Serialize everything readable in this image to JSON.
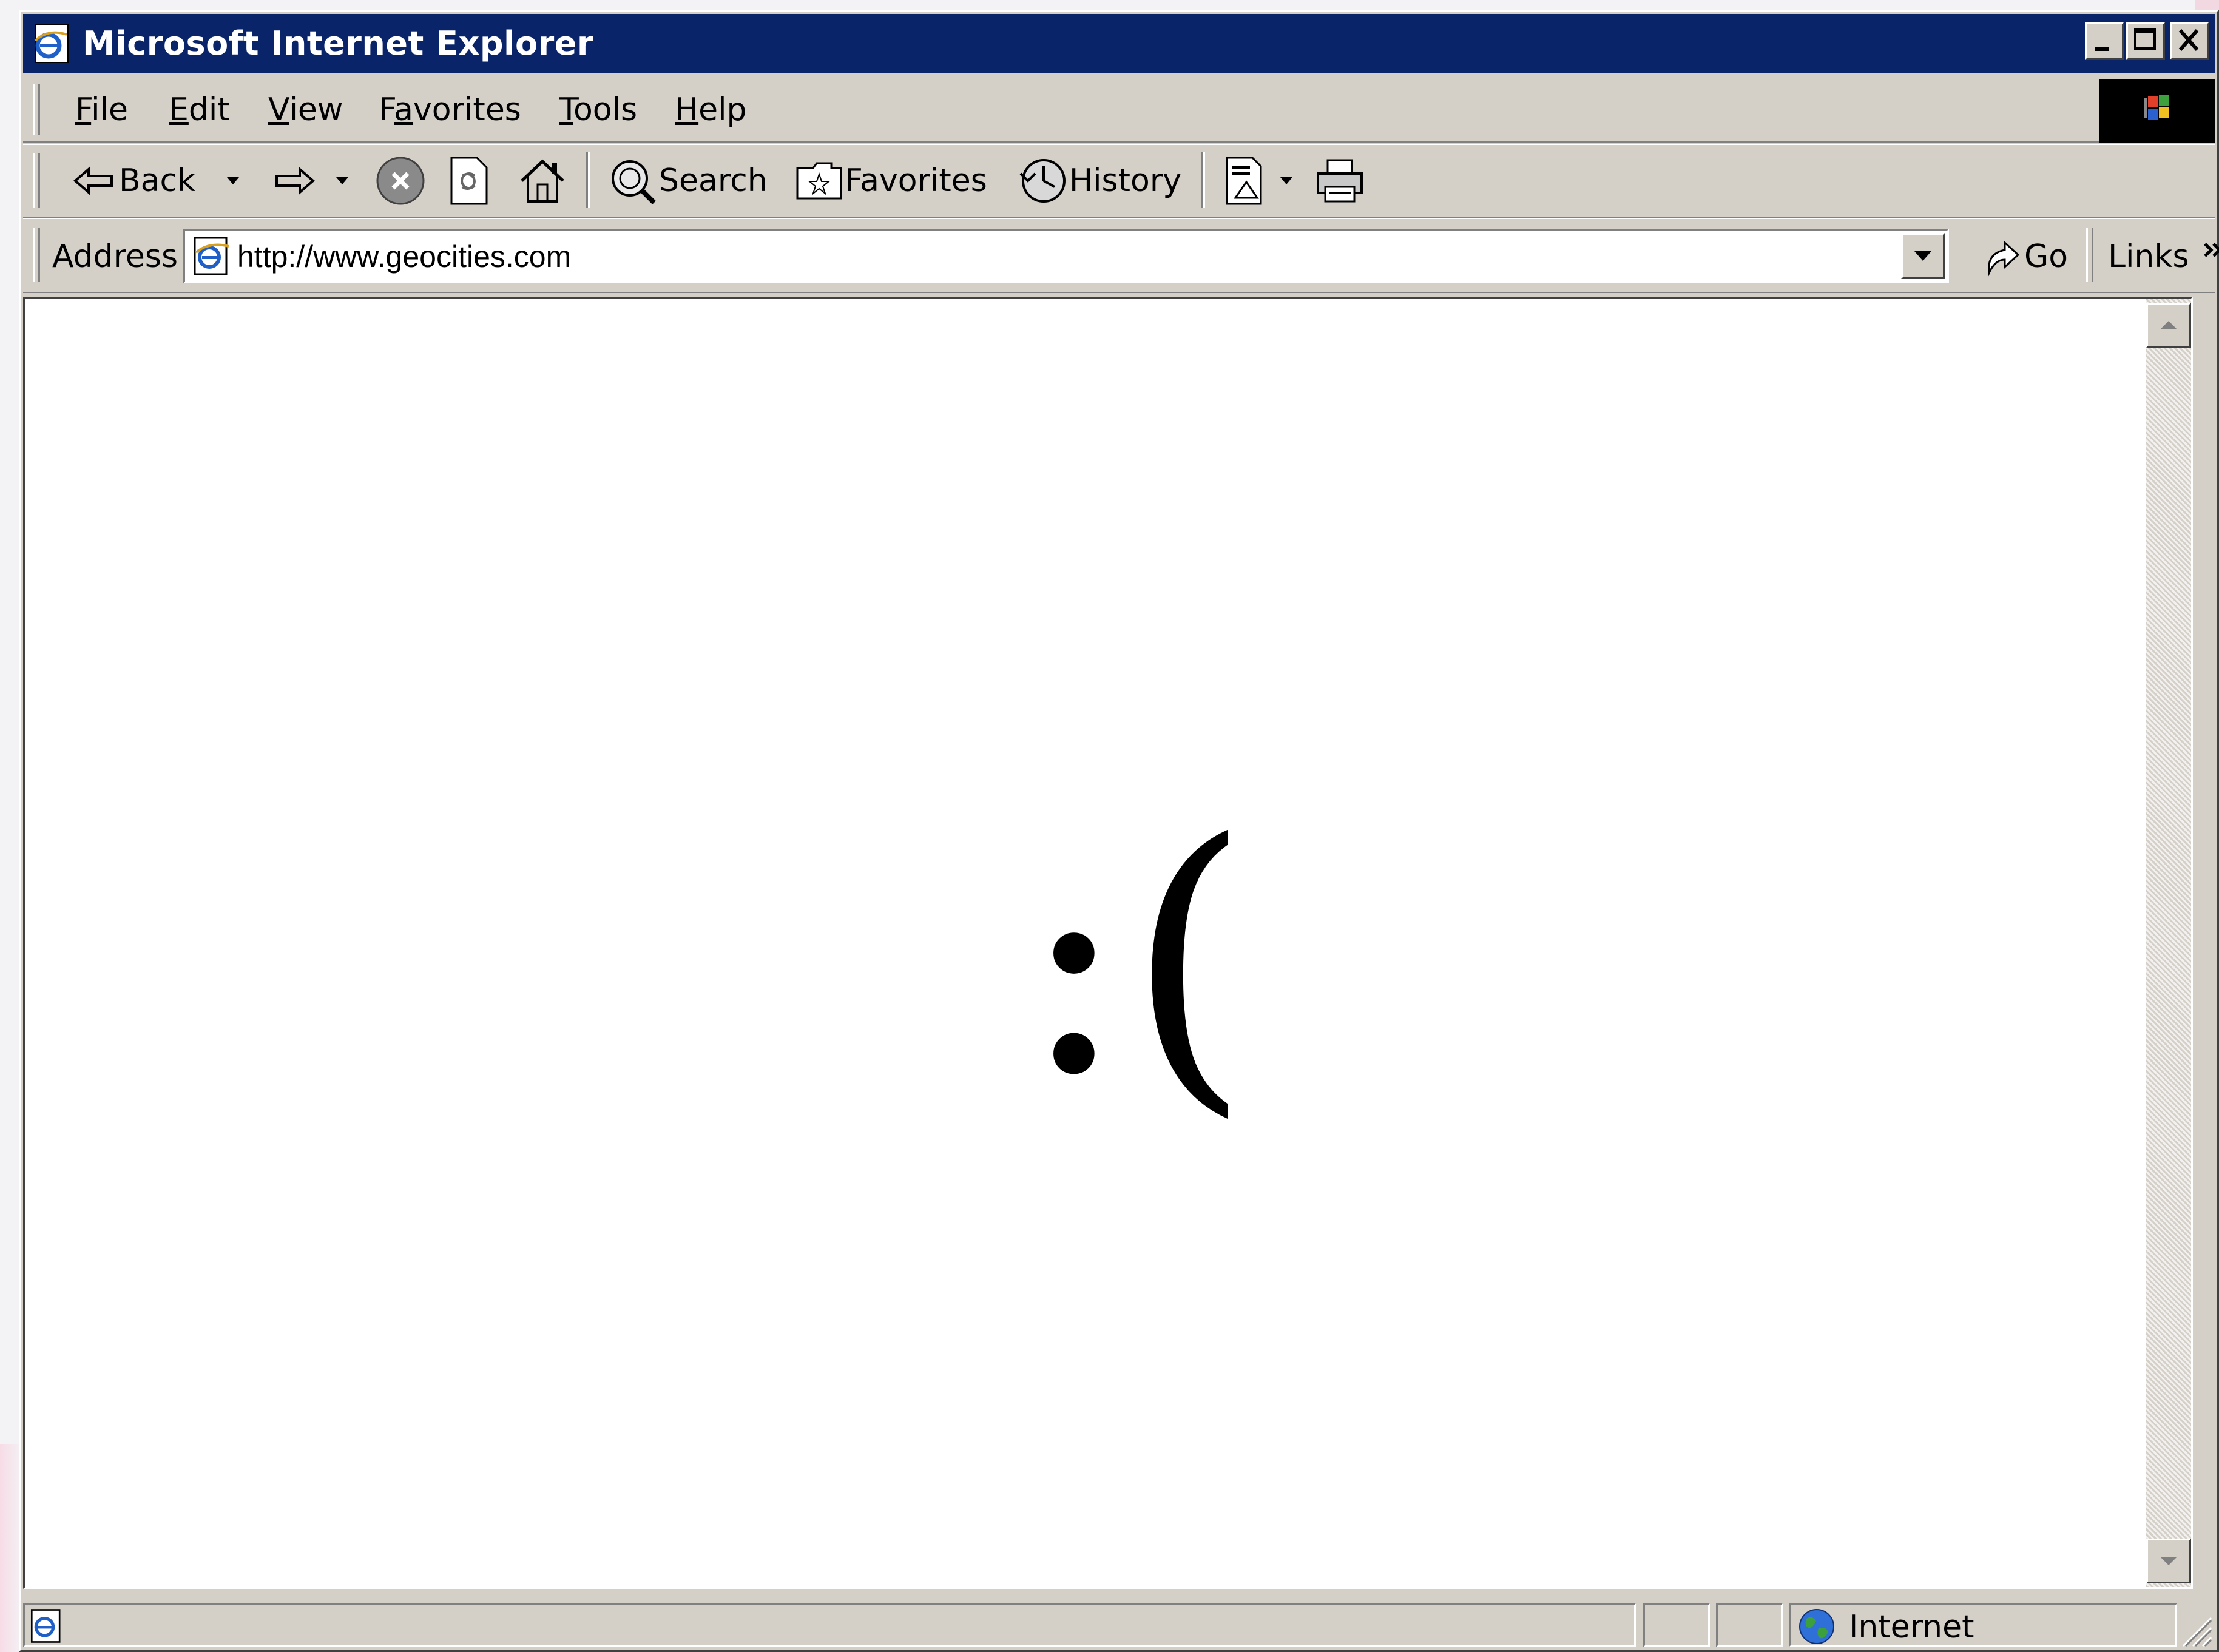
{
  "window": {
    "title": "Microsoft Internet Explorer"
  },
  "menu": {
    "items": [
      {
        "label": "File",
        "mnemonic": "F"
      },
      {
        "label": "Edit",
        "mnemonic": "E"
      },
      {
        "label": "View",
        "mnemonic": "V"
      },
      {
        "label": "Favorites",
        "mnemonic": "a"
      },
      {
        "label": "Tools",
        "mnemonic": "T"
      },
      {
        "label": "Help",
        "mnemonic": "H"
      }
    ]
  },
  "toolbar": {
    "back_label": "Back",
    "search_label": "Search",
    "favorites_label": "Favorites",
    "history_label": "History"
  },
  "address": {
    "label": "Address",
    "url": "http://www.geocities.com",
    "go_label": "Go",
    "links_label": "Links"
  },
  "content": {
    "text": ":("
  },
  "status": {
    "zone_label": "Internet"
  },
  "colors": {
    "titlebar": "#0a246a",
    "chrome": "#d4d0c8"
  }
}
